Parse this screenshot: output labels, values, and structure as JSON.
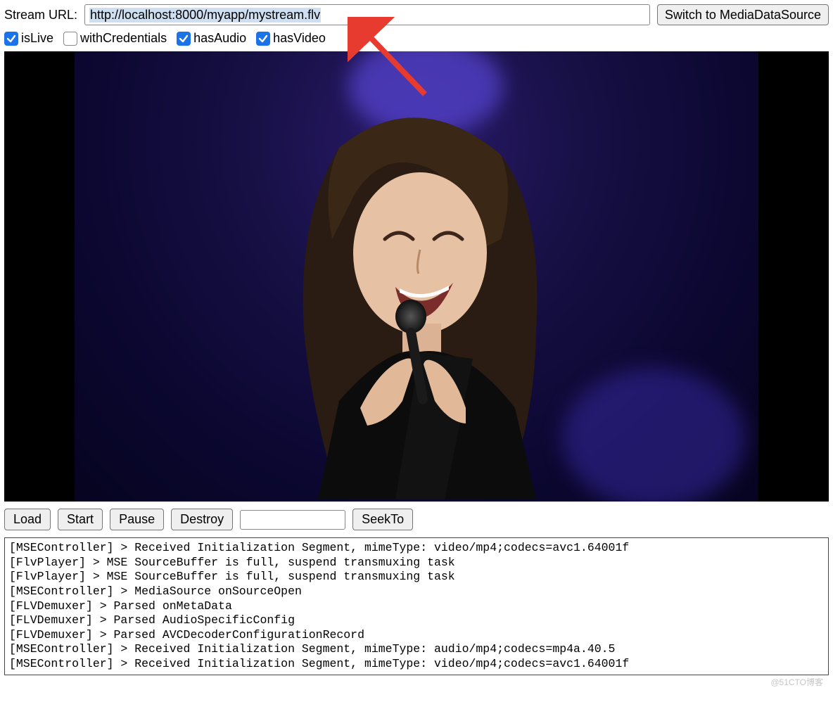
{
  "top": {
    "url_label": "Stream URL:",
    "url_value": "http://localhost:8000/myapp/mystream.flv",
    "switch_label": "Switch to MediaDataSource"
  },
  "checkboxes": [
    {
      "label": "isLive",
      "checked": true
    },
    {
      "label": "withCredentials",
      "checked": false
    },
    {
      "label": "hasAudio",
      "checked": true
    },
    {
      "label": "hasVideo",
      "checked": true
    }
  ],
  "controls": {
    "load": "Load",
    "start": "Start",
    "pause": "Pause",
    "destroy": "Destroy",
    "seek_value": "",
    "seekto": "SeekTo"
  },
  "log_lines": [
    "[MSEController] > Received Initialization Segment, mimeType: video/mp4;codecs=avc1.64001f",
    "[FlvPlayer] > MSE SourceBuffer is full, suspend transmuxing task",
    "[FlvPlayer] > MSE SourceBuffer is full, suspend transmuxing task",
    "[MSEController] > MediaSource onSourceOpen",
    "[FLVDemuxer] > Parsed onMetaData",
    "[FLVDemuxer] > Parsed AudioSpecificConfig",
    "[FLVDemuxer] > Parsed AVCDecoderConfigurationRecord",
    "[MSEController] > Received Initialization Segment, mimeType: audio/mp4;codecs=mp4a.40.5",
    "[MSEController] > Received Initialization Segment, mimeType: video/mp4;codecs=avc1.64001f"
  ],
  "watermark": "@51CTO博客"
}
